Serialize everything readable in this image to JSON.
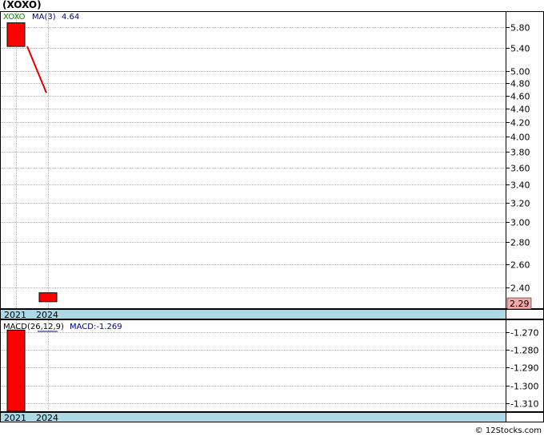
{
  "title": "(XOXO)",
  "copyright": "© 12Stocks.com",
  "chart_data": [
    {
      "type": "candlestick",
      "legend": {
        "symbol": "XOXO",
        "ma_label": "MA(3)",
        "ma_value": "4.64"
      },
      "x_labels": [
        "2021",
        "2024"
      ],
      "y_ticks": [
        "5.80",
        "5.40",
        "5.00",
        "4.80",
        "4.60",
        "4.40",
        "4.20",
        "4.00",
        "3.80",
        "3.60",
        "3.40",
        "3.20",
        "3.00",
        "2.80",
        "2.60",
        "2.40"
      ],
      "ylim": [
        2.24,
        6.1
      ],
      "scale": "log",
      "candles": [
        {
          "x": "2021",
          "open": 5.88,
          "close": 5.43,
          "color": "#ff0000"
        },
        {
          "x": "2024",
          "open": 2.36,
          "close": 2.29,
          "color": "#ff0000"
        }
      ],
      "ma_line": {
        "points": [
          {
            "x": "2021",
            "y": 5.43
          },
          {
            "x": "2024",
            "y": 4.64
          }
        ],
        "color": "#e00000"
      },
      "last_price": "2.29",
      "last_price_bg": "#f4a9a9"
    },
    {
      "type": "bar",
      "legend": {
        "name": "MACD(26,12,9)",
        "value_label": "MACD:-1.269"
      },
      "x_labels": [
        "2021",
        "2024"
      ],
      "y_ticks": [
        "-1.270",
        "-1.280",
        "-1.290",
        "-1.300",
        "-1.310"
      ],
      "ylim": [
        -1.3145,
        -1.2635
      ],
      "bars": [
        {
          "x": "2021",
          "value": -1.269,
          "color": "#ff0000"
        }
      ]
    }
  ],
  "colors": {
    "axis_strip": "#add8e6",
    "grid": "#b0b0b0",
    "ticker": "#008000",
    "ma_text": "#00008b"
  }
}
